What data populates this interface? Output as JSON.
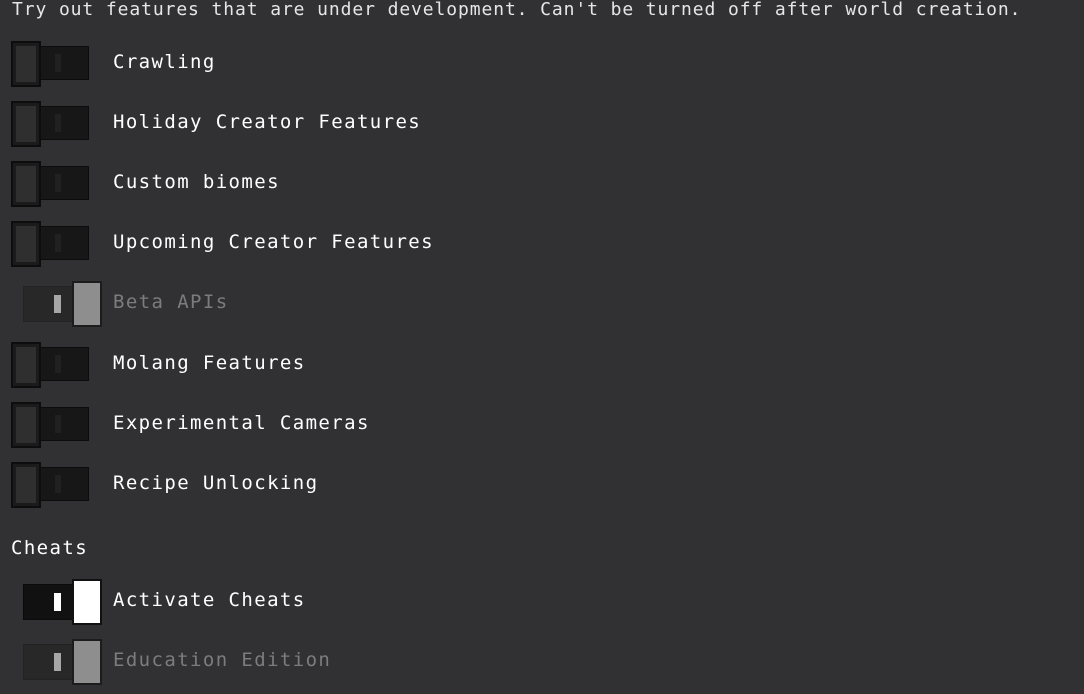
{
  "intro_text": "Try out features that are under development. Can't be turned off after world creation.",
  "experiments": [
    {
      "label": "Crawling",
      "state": "off",
      "enabled": true
    },
    {
      "label": "Holiday Creator Features",
      "state": "off",
      "enabled": true
    },
    {
      "label": "Custom biomes",
      "state": "off",
      "enabled": true
    },
    {
      "label": "Upcoming Creator Features",
      "state": "off",
      "enabled": true
    },
    {
      "label": "Beta APIs",
      "state": "on",
      "enabled": false
    },
    {
      "label": "Molang Features",
      "state": "off",
      "enabled": true
    },
    {
      "label": "Experimental Cameras",
      "state": "off",
      "enabled": true
    },
    {
      "label": "Recipe Unlocking",
      "state": "off",
      "enabled": true
    }
  ],
  "cheats": {
    "section_title": "Cheats",
    "items": [
      {
        "label": "Activate Cheats",
        "state": "on",
        "enabled": true
      },
      {
        "label": "Education Edition",
        "state": "on",
        "enabled": false
      }
    ]
  },
  "colors": {
    "background": "#313133",
    "label_text": "#ffffff",
    "disabled_text": "#7c7c7c"
  }
}
